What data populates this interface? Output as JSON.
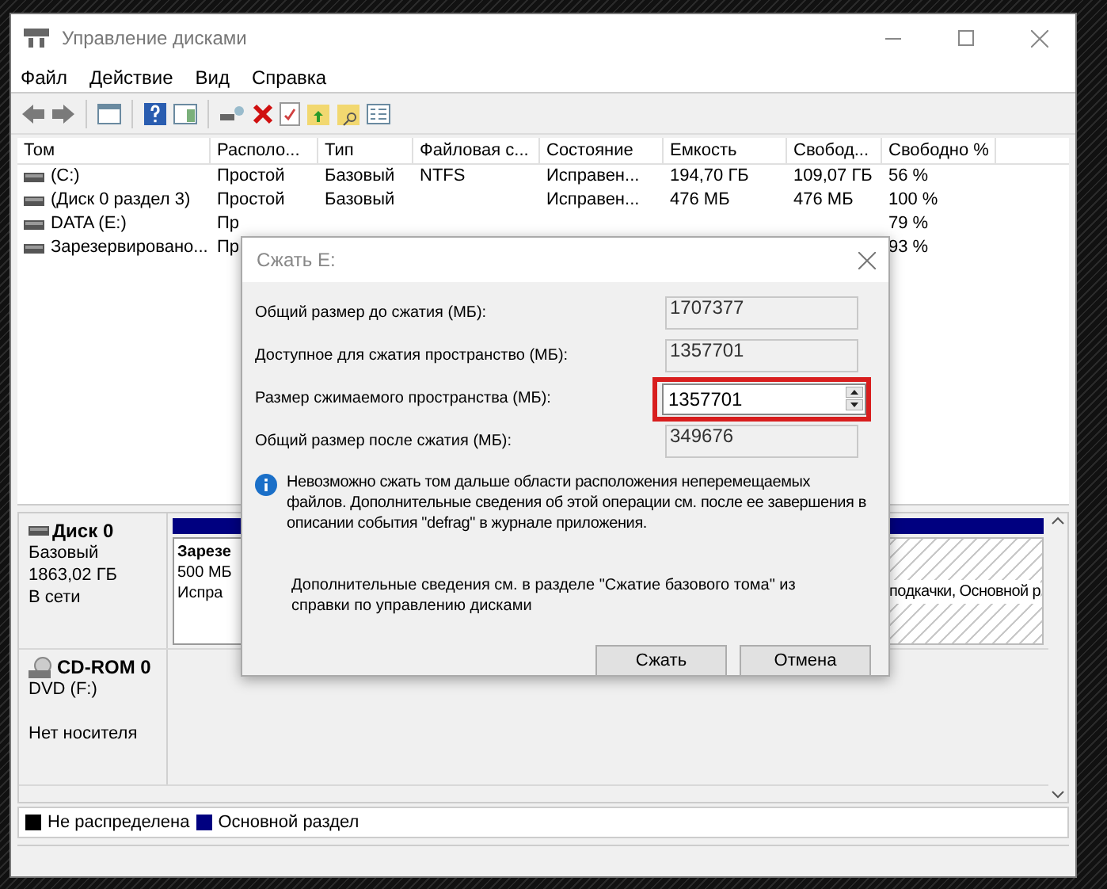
{
  "window": {
    "title": "Управление дисками"
  },
  "menu": [
    "Файл",
    "Действие",
    "Вид",
    "Справка"
  ],
  "table": {
    "columns": [
      "Том",
      "Располо...",
      "Тип",
      "Файловая с...",
      "Состояние",
      "Емкость",
      "Свобод...",
      "Свободно %"
    ],
    "rows": [
      {
        "cells": [
          "(C:)",
          "Простой",
          "Базовый",
          "NTFS",
          "Исправен...",
          "194,70 ГБ",
          "109,07 ГБ",
          "56 %"
        ]
      },
      {
        "cells": [
          "(Диск 0 раздел 3)",
          "Простой",
          "Базовый",
          "",
          "Исправен...",
          "476 МБ",
          "476 МБ",
          "100 %"
        ]
      },
      {
        "cells": [
          "DATA (E:)",
          "Пр",
          "",
          "",
          "",
          "",
          "",
          "79 %"
        ]
      },
      {
        "cells": [
          "Зарезервировано...",
          "Пр",
          "",
          "",
          "",
          "",
          "",
          "93 %"
        ]
      }
    ]
  },
  "disks": [
    {
      "name": "Диск 0",
      "kind": "hdd",
      "lines": [
        "Базовый",
        "1863,02 ГБ"
      ],
      "status": "В сети",
      "partitions": [
        {
          "lines": [
            "Зарезе",
            "500 МБ",
            "Испра"
          ],
          "hatched": false
        },
        {
          "lines": [
            "подкачки, Основной р"
          ],
          "hatched": true
        }
      ]
    },
    {
      "name": "CD-ROM 0",
      "kind": "cdrom",
      "lines": [
        "DVD (F:)"
      ],
      "status": "Нет носителя"
    }
  ],
  "legend": [
    {
      "label": "Не распределена",
      "color": "#000000"
    },
    {
      "label": "Основной раздел",
      "color": "#000080"
    }
  ],
  "dialog": {
    "title": "Сжать E:",
    "fields": [
      {
        "label": "Общий размер до сжатия (МБ):",
        "value": "1707377",
        "kind": "readonly"
      },
      {
        "label": "Доступное для сжатия пространство (МБ):",
        "value": "1357701",
        "kind": "readonly"
      },
      {
        "label": "Размер сжимаемого пространства (МБ):",
        "value": "1357701",
        "kind": "spin",
        "highlighted": true
      },
      {
        "label": "Общий размер после сжатия (МБ):",
        "value": "349676",
        "kind": "readonly"
      }
    ],
    "info": "Невозможно сжать том дальше области расположения неперемещаемых файлов. Дополнительные сведения об этой операции см. после ее завершения в описании события \"defrag\" в журнале приложения.",
    "help": "Дополнительные сведения см. в разделе \"Сжатие базового тома\" из справки по управлению дисками",
    "buttons": [
      "Сжать",
      "Отмена"
    ]
  }
}
